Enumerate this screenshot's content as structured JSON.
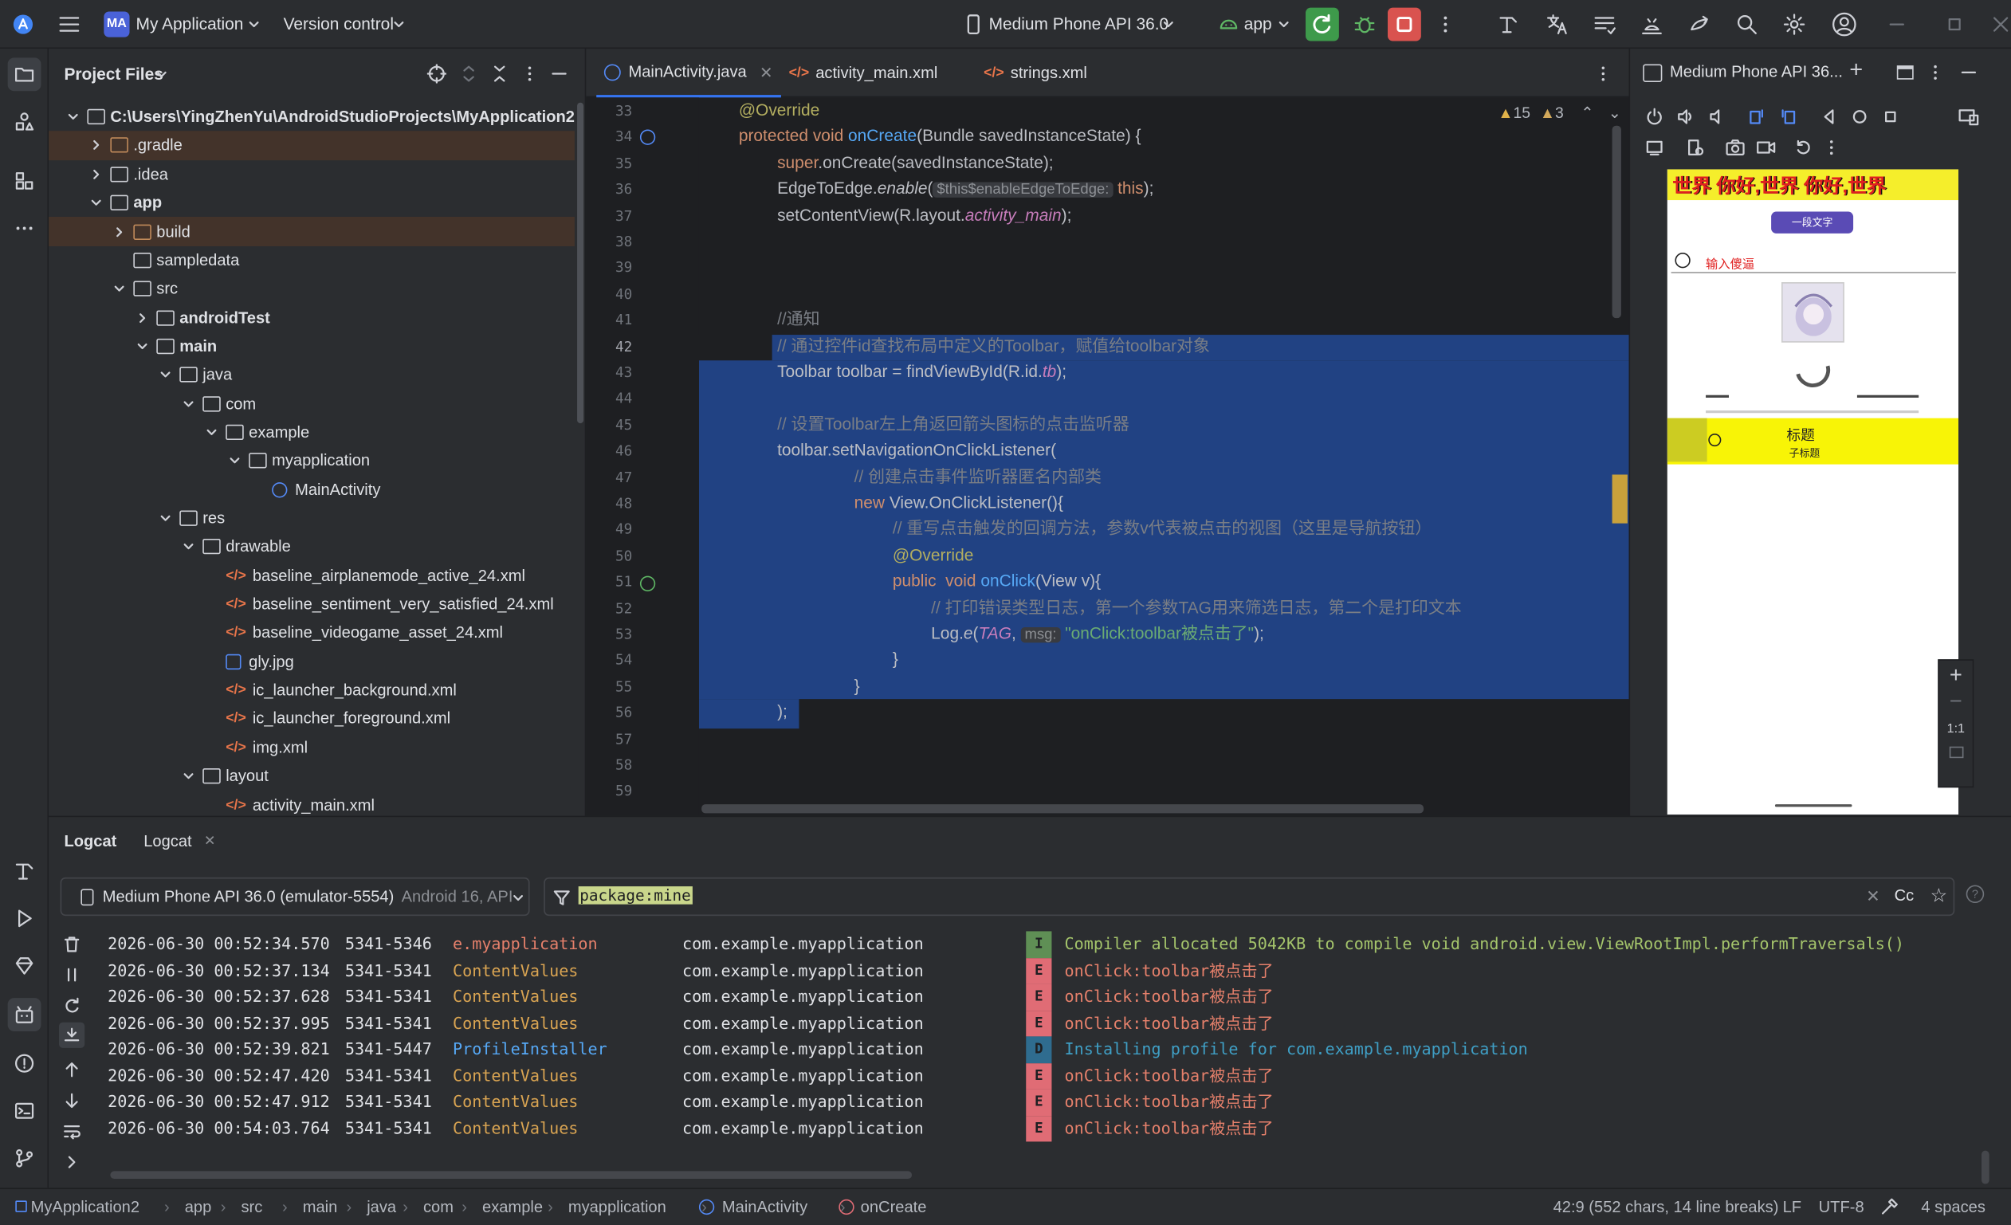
{
  "titlebar": {
    "app_badge": "MA",
    "project_name": "My Application",
    "vcs": "Version control",
    "device": "Medium Phone API 36.0",
    "run_config": "app"
  },
  "project_panel": {
    "title": "Project Files",
    "items": [
      {
        "label": "C:\\Users\\YingZhenYu\\AndroidStudioProjects\\MyApplication2",
        "bold": true
      },
      {
        "label": ".gradle"
      },
      {
        "label": ".idea"
      },
      {
        "label": "app",
        "bold": true
      },
      {
        "label": "build"
      },
      {
        "label": "sampledata"
      },
      {
        "label": "src"
      },
      {
        "label": "androidTest",
        "bold": true
      },
      {
        "label": "main",
        "bold": true
      },
      {
        "label": "java"
      },
      {
        "label": "com"
      },
      {
        "label": "example"
      },
      {
        "label": "myapplication"
      },
      {
        "label": "MainActivity"
      },
      {
        "label": "res"
      },
      {
        "label": "drawable"
      },
      {
        "label": "baseline_airplanemode_active_24.xml"
      },
      {
        "label": "baseline_sentiment_very_satisfied_24.xml"
      },
      {
        "label": "baseline_videogame_asset_24.xml"
      },
      {
        "label": "gly.jpg"
      },
      {
        "label": "ic_launcher_background.xml"
      },
      {
        "label": "ic_launcher_foreground.xml"
      },
      {
        "label": "img.xml"
      },
      {
        "label": "layout"
      },
      {
        "label": "activity_main.xml"
      }
    ]
  },
  "editor": {
    "tabs": [
      {
        "label": "MainActivity.java",
        "active": true
      },
      {
        "label": "activity_main.xml"
      },
      {
        "label": "strings.xml"
      }
    ],
    "warnings": "15",
    "weak_warnings": "3",
    "line_numbers": [
      "33",
      "34",
      "35",
      "36",
      "37",
      "38",
      "39",
      "40",
      "41",
      "42",
      "43",
      "44",
      "45",
      "46",
      "47",
      "48",
      "49",
      "50",
      "51",
      "52",
      "53",
      "54",
      "55",
      "56",
      "57",
      "58",
      "59"
    ],
    "code": {
      "l33_ann": "@Override",
      "l34_kw": "protected void ",
      "l34_fn": "onCreate",
      "l34_rest": "(Bundle savedInstanceState) {",
      "l35_kw": "super",
      "l35_rest": ".onCreate(savedInstanceState);",
      "l36_a": "EdgeToEdge.",
      "l36_b": "enable",
      "l36_c": "(",
      "l36_hint": "$this$enableEdgeToEdge:",
      "l36_kw": " this",
      "l36_d": ");",
      "l37_a": "setContentView(R.layout.",
      "l37_b": "activity_main",
      "l37_c": ");",
      "l41": "//通知",
      "l42": "// 通过控件id查找布局中定义的Toolbar，赋值给toolbar对象",
      "l43_a": "Toolbar toolbar = findViewById(R.id.",
      "l43_b": "tb",
      "l43_c": ");",
      "l45": "// 设置Toolbar左上角返回箭头图标的点击监听器",
      "l46": "toolbar.setNavigationOnClickListener(",
      "l47": "// 创建点击事件监听器匿名内部类",
      "l48_kw": "new ",
      "l48_rest": "View.OnClickListener(){",
      "l49": "// 重写点击触发的回调方法，参数v代表被点击的视图（这里是导航按钮）",
      "l50": "@Override",
      "l51_kw": "public  void ",
      "l51_fn": "onClick",
      "l51_rest": "(View v){",
      "l52": "// 打印错误类型日志，第一个参数TAG用来筛选日志，第二个是打印文本",
      "l53_a": "Log.",
      "l53_b": "e",
      "l53_c": "(",
      "l53_tag": "TAG",
      "l53_d": ", ",
      "l53_hint": "msg:",
      "l53_str": " \"onClick:toolbar被点击了\"",
      "l53_e": ");",
      "l54": "}",
      "l55": "}",
      "l56": ");"
    }
  },
  "emulator": {
    "title": "Medium Phone API 36...",
    "zoom_label": "1:1",
    "app_banner": "世界 你好,世界 你好,世界",
    "pill_button": "一段文字",
    "input_label": "输入傻逼",
    "toolbar_title": "标题",
    "toolbar_subtitle": "子标题"
  },
  "logcat": {
    "tab_title": "Logcat",
    "tab_second": "Logcat",
    "device": "Medium Phone API 36.0 (emulator-5554)",
    "device_os": "Android 16, API",
    "filter": "package:mine",
    "case_label": "Cc",
    "rows": [
      {
        "time": "2026-06-30 00:52:34.570",
        "pid": "5341-5346",
        "tag": "e.myapplication",
        "pkg": "com.example.myapplication",
        "level": "I",
        "msg": "Compiler allocated 5042KB to compile void android.view.ViewRootImpl.performTraversals()"
      },
      {
        "time": "2026-06-30 00:52:37.134",
        "pid": "5341-5341",
        "tag": "ContentValues",
        "pkg": "com.example.myapplication",
        "level": "E",
        "msg": "onClick:toolbar被点击了"
      },
      {
        "time": "2026-06-30 00:52:37.628",
        "pid": "5341-5341",
        "tag": "ContentValues",
        "pkg": "com.example.myapplication",
        "level": "E",
        "msg": "onClick:toolbar被点击了"
      },
      {
        "time": "2026-06-30 00:52:37.995",
        "pid": "5341-5341",
        "tag": "ContentValues",
        "pkg": "com.example.myapplication",
        "level": "E",
        "msg": "onClick:toolbar被点击了"
      },
      {
        "time": "2026-06-30 00:52:39.821",
        "pid": "5341-5447",
        "tag": "ProfileInstaller",
        "pkg": "com.example.myapplication",
        "level": "D",
        "msg": "Installing profile for com.example.myapplication"
      },
      {
        "time": "2026-06-30 00:52:47.420",
        "pid": "5341-5341",
        "tag": "ContentValues",
        "pkg": "com.example.myapplication",
        "level": "E",
        "msg": "onClick:toolbar被点击了"
      },
      {
        "time": "2026-06-30 00:52:47.912",
        "pid": "5341-5341",
        "tag": "ContentValues",
        "pkg": "com.example.myapplication",
        "level": "E",
        "msg": "onClick:toolbar被点击了"
      },
      {
        "time": "2026-06-30 00:54:03.764",
        "pid": "5341-5341",
        "tag": "ContentValues",
        "pkg": "com.example.myapplication",
        "level": "E",
        "msg": "onClick:toolbar被点击了"
      }
    ]
  },
  "statusbar": {
    "breadcrumbs": [
      "MyApplication2",
      "app",
      "src",
      "main",
      "java",
      "com",
      "example",
      "myapplication",
      "MainActivity",
      "onCreate"
    ],
    "position": "42:9 (552 chars, 14 line breaks)",
    "line_sep": "LF",
    "encoding": "UTF-8",
    "indent": "4 spaces"
  },
  "colors": {
    "accent": "#3574f0",
    "selection": "#214283",
    "level_E": "#e06c75",
    "level_I": "#5f8f55",
    "level_D": "#2f6c8f",
    "run_green": "#3e9a4b",
    "stop_red": "#d9534f"
  }
}
